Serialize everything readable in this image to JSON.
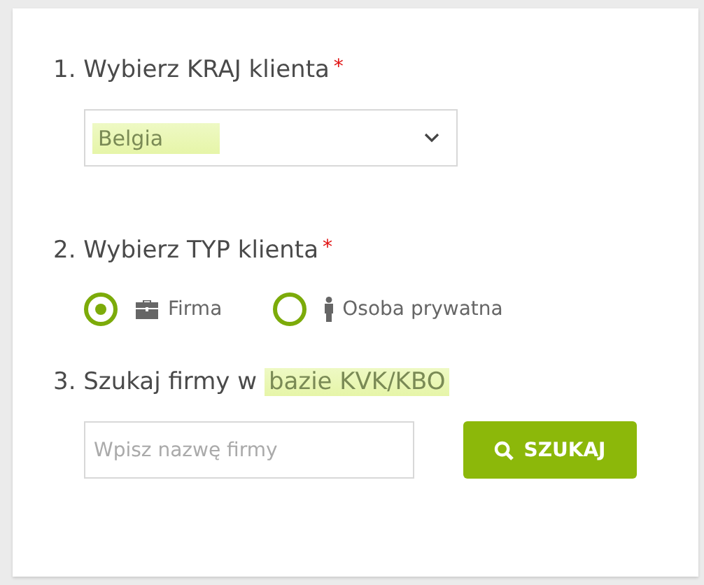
{
  "sections": [
    {
      "kind": "select",
      "title": [
        {
          "text": "1. Wybierz KRAJ klienta",
          "highlighted": false
        }
      ],
      "required_mark": "*",
      "select": {
        "value": "Belgia",
        "highlighted": true
      }
    },
    {
      "kind": "radio",
      "title": [
        {
          "text": "2. Wybierz TYP klienta",
          "highlighted": false
        }
      ],
      "required_mark": "*",
      "options": [
        {
          "label": "Firma",
          "kind": "company",
          "selected": true
        },
        {
          "label": "Osoba prywatna",
          "kind": "person",
          "selected": false
        }
      ]
    },
    {
      "kind": "search",
      "title": [
        {
          "text": "3. Szukaj firmy w ",
          "highlighted": false
        },
        {
          "text": "bazie KVK/KBO",
          "highlighted": true
        }
      ],
      "search": {
        "placeholder": "Wpisz nazwę firmy",
        "button": "SZUKAJ"
      }
    }
  ]
}
